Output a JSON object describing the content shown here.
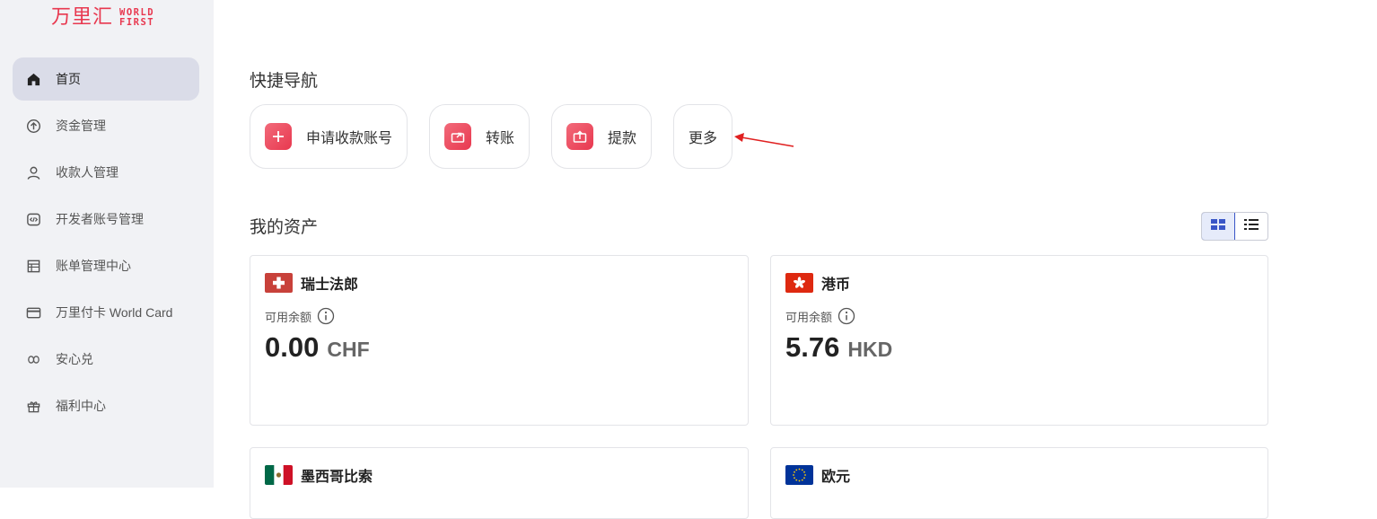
{
  "logo": {
    "cn": "万里汇",
    "en_line1": "WORLD",
    "en_line2": "FIRST"
  },
  "sidebar": {
    "items": [
      {
        "label": "首页",
        "icon": "home-icon",
        "active": true
      },
      {
        "label": "资金管理",
        "icon": "arrow-up-circle-icon"
      },
      {
        "label": "收款人管理",
        "icon": "user-icon"
      },
      {
        "label": "开发者账号管理",
        "icon": "code-icon"
      },
      {
        "label": "账单管理中心",
        "icon": "table-icon"
      },
      {
        "label": "万里付卡 World Card",
        "icon": "credit-card-icon"
      },
      {
        "label": "安心兑",
        "icon": "exchange-icon"
      },
      {
        "label": "福利中心",
        "icon": "gift-icon"
      }
    ]
  },
  "quick_nav": {
    "title": "快捷导航",
    "items": [
      {
        "label": "申请收款账号",
        "icon": "plus-icon"
      },
      {
        "label": "转账",
        "icon": "transfer-icon"
      },
      {
        "label": "提款",
        "icon": "withdraw-icon"
      },
      {
        "label": "更多"
      }
    ]
  },
  "assets": {
    "title": "我的资产",
    "available_label": "可用余额",
    "cards": [
      {
        "name": "瑞士法郎",
        "amount": "0.00",
        "currency": "CHF",
        "flag": "switzerland-flag"
      },
      {
        "name": "港币",
        "amount": "5.76",
        "currency": "HKD",
        "flag": "hong-kong-flag"
      },
      {
        "name": "墨西哥比索",
        "flag": "mexico-flag"
      },
      {
        "name": "欧元",
        "flag": "eu-flag"
      }
    ]
  },
  "colors": {
    "brand": "#e8384f",
    "accent": "#3a56c7",
    "sidebar_bg": "#f1f2f5",
    "active_bg": "#dadce8",
    "arrow": "#e02020"
  }
}
